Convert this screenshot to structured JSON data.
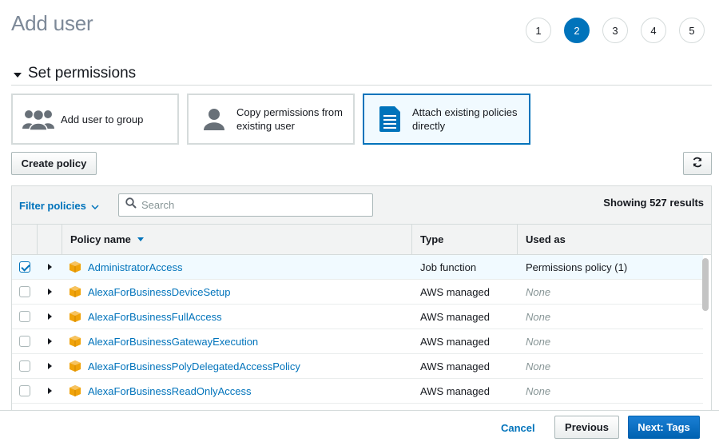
{
  "page": {
    "title": "Add user"
  },
  "steps": [
    "1",
    "2",
    "3",
    "4",
    "5"
  ],
  "active_step": "2",
  "section": {
    "title": "Set permissions"
  },
  "options": [
    {
      "label": "Add user to group",
      "icon": "user-group-icon"
    },
    {
      "label": "Copy permissions from existing user",
      "icon": "user-icon"
    },
    {
      "label": "Attach existing policies directly",
      "icon": "document-icon"
    }
  ],
  "selected_option": 2,
  "toolbar": {
    "create_policy_label": "Create policy",
    "refresh_icon": "refresh-icon"
  },
  "filter": {
    "label": "Filter policies",
    "search_placeholder": "Search",
    "results_text": "Showing 527 results"
  },
  "table": {
    "columns": [
      "Policy name",
      "Type",
      "Used as"
    ],
    "rows": [
      {
        "name": "AdministratorAccess",
        "type": "Job function",
        "used_as": "Permissions policy (1)",
        "checked": true
      },
      {
        "name": "AlexaForBusinessDeviceSetup",
        "type": "AWS managed",
        "used_as": "None",
        "checked": false
      },
      {
        "name": "AlexaForBusinessFullAccess",
        "type": "AWS managed",
        "used_as": "None",
        "checked": false
      },
      {
        "name": "AlexaForBusinessGatewayExecution",
        "type": "AWS managed",
        "used_as": "None",
        "checked": false
      },
      {
        "name": "AlexaForBusinessPolyDelegatedAccessPolicy",
        "type": "AWS managed",
        "used_as": "None",
        "checked": false
      },
      {
        "name": "AlexaForBusinessReadOnlyAccess",
        "type": "AWS managed",
        "used_as": "None",
        "checked": false
      }
    ]
  },
  "footer": {
    "cancel_label": "Cancel",
    "previous_label": "Previous",
    "next_label": "Next: Tags"
  },
  "colors": {
    "accent": "#0073bb",
    "policy_icon": "#f0a30a",
    "muted": "#879596"
  }
}
